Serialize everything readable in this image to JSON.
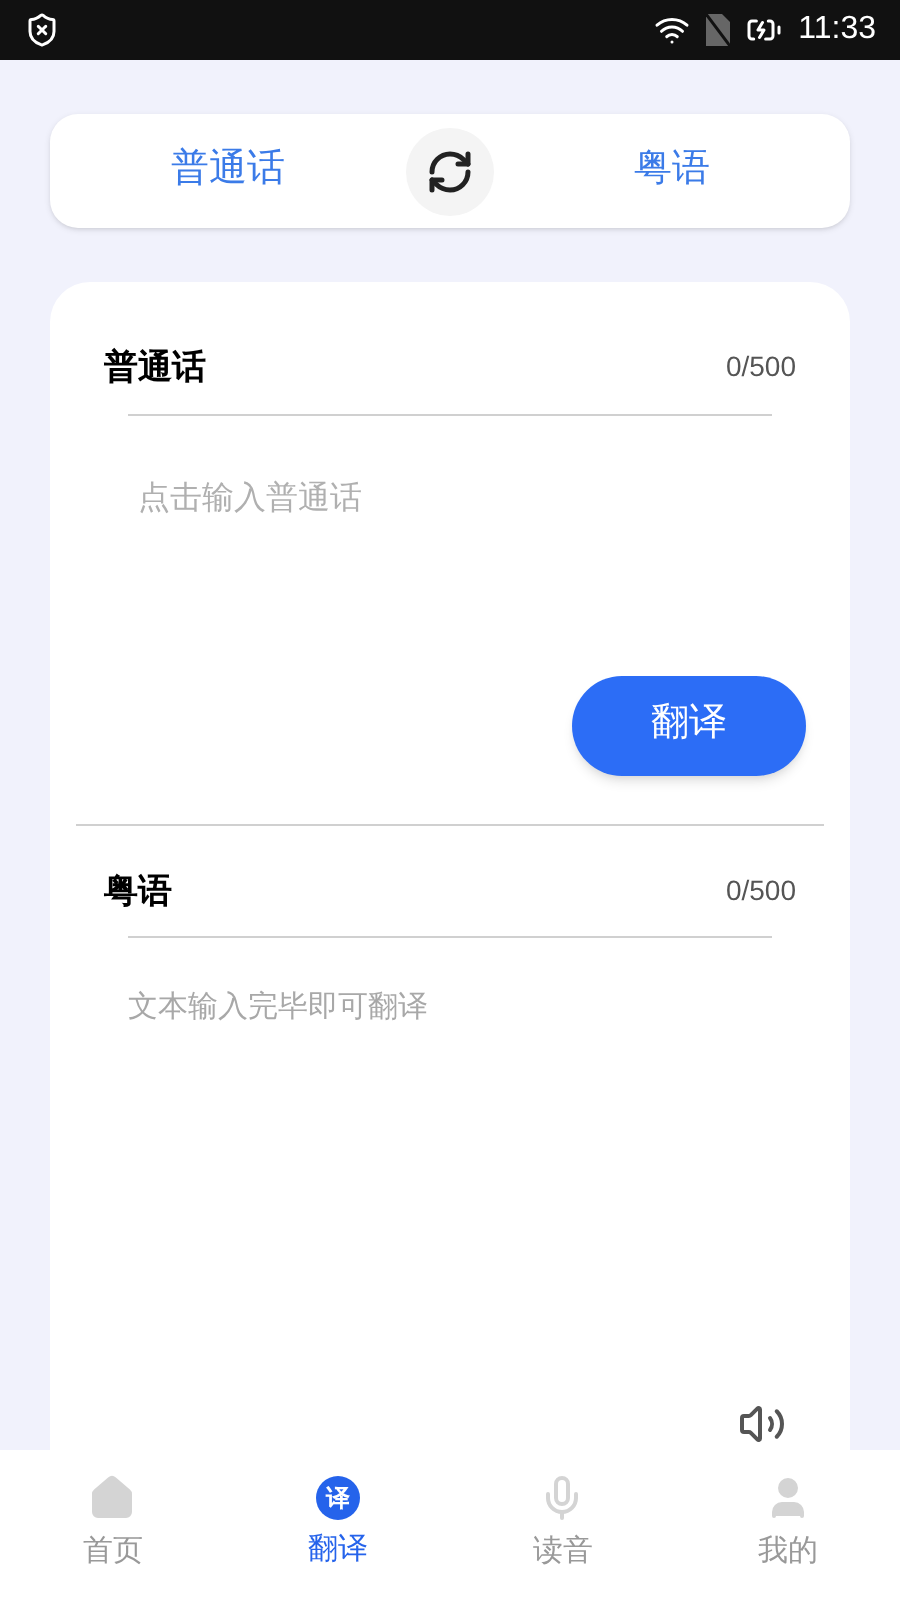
{
  "status_bar": {
    "time": "11:33"
  },
  "language_bar": {
    "source": "普通话",
    "target": "粤语"
  },
  "source_panel": {
    "title": "普通话",
    "count": "0/500",
    "placeholder": "点击输入普通话",
    "button": "翻译"
  },
  "target_panel": {
    "title": "粤语",
    "count": "0/500",
    "hint": "文本输入完毕即可翻译"
  },
  "nav": [
    {
      "kind": "home",
      "label": "首页",
      "selected": false
    },
    {
      "kind": "translate",
      "label": "翻译",
      "icon_text": "译",
      "selected": true
    },
    {
      "kind": "mic",
      "label": "读音",
      "selected": false
    },
    {
      "kind": "user",
      "label": "我的",
      "selected": false
    }
  ]
}
